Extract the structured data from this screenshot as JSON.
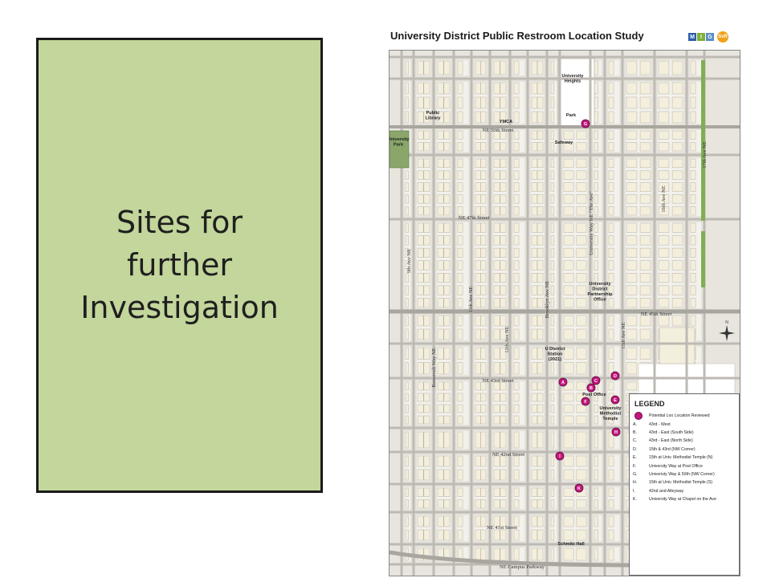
{
  "slide": {
    "box_text": "Sites for further Investigation",
    "box_color": "#c3d69b"
  },
  "map": {
    "title": "University District Public Restroom Location Study",
    "logo_letters": [
      "M",
      "I",
      "G",
      "SvR"
    ],
    "street_labels": [
      {
        "id": "ne50",
        "text": "NE 50th Street"
      },
      {
        "id": "ne47",
        "text": "NE 47th Street"
      },
      {
        "id": "ne45",
        "text": "NE 45th Street"
      },
      {
        "id": "ne43",
        "text": "NE 43rd Street"
      },
      {
        "id": "ne42",
        "text": "NE 42nd Street"
      },
      {
        "id": "ne41",
        "text": "NE 41st Street"
      },
      {
        "id": "campus",
        "text": "NE Campus Parkway"
      },
      {
        "id": "ave9",
        "text": "9th Ave NE"
      },
      {
        "id": "ave11",
        "text": "11th Ave NE"
      },
      {
        "id": "ave12",
        "text": "12th Ave NE"
      },
      {
        "id": "brooklyn",
        "text": "Brooklyn Ave NE"
      },
      {
        "id": "univway",
        "text": "University Way NE \"The Ave\""
      },
      {
        "id": "ave15",
        "text": "15th Ave NE"
      },
      {
        "id": "ave16",
        "text": "16th Ave NE"
      },
      {
        "id": "ave17",
        "text": "17th Ave NE"
      },
      {
        "id": "roosevelt",
        "text": "Roosevelt Way NE"
      }
    ],
    "place_labels": [
      {
        "id": "uheights",
        "lines": [
          "University",
          "Heights"
        ]
      },
      {
        "id": "park",
        "lines": [
          "Park"
        ]
      },
      {
        "id": "library",
        "lines": [
          "Public",
          "Library"
        ]
      },
      {
        "id": "ymca",
        "lines": [
          "YMCA"
        ]
      },
      {
        "id": "safeway",
        "lines": [
          "Safeway"
        ]
      },
      {
        "id": "upark",
        "lines": [
          "University",
          "Park"
        ]
      },
      {
        "id": "partnership",
        "lines": [
          "University",
          "District",
          "Partnership",
          "Office"
        ]
      },
      {
        "id": "station",
        "lines": [
          "U District",
          "Station",
          "(2021)"
        ]
      },
      {
        "id": "postoffice",
        "lines": [
          "Post Office"
        ]
      },
      {
        "id": "methodist",
        "lines": [
          "University",
          "Methodist",
          "Temple"
        ]
      },
      {
        "id": "schmitz",
        "lines": [
          "Schmitz Hall"
        ]
      }
    ],
    "markers": [
      "A",
      "B",
      "C",
      "D",
      "E",
      "F",
      "G",
      "H",
      "I",
      "K"
    ],
    "compass": "N",
    "marker_color": "#c4167e"
  },
  "legend": {
    "title": "LEGEND",
    "dot_label": "Potential Loo Location Reviewed",
    "items": [
      {
        "letter": "A.",
        "text": "43rd - West"
      },
      {
        "letter": "B.",
        "text": "43rd - East (South Side)"
      },
      {
        "letter": "C.",
        "text": "43rd - East (North Side)"
      },
      {
        "letter": "D.",
        "text": "15th & 43rd (NW Corner)"
      },
      {
        "letter": "E.",
        "text": "15th at Univ. Methodist Temple (N)"
      },
      {
        "letter": "F.",
        "text": "University Way at Post Office"
      },
      {
        "letter": "G.",
        "text": "Univeristy Way & 50th (NW Corner)"
      },
      {
        "letter": "H.",
        "text": "15th at Univ. Methodist Temple (S)"
      },
      {
        "letter": "I.",
        "text": "42nd and Alleyway"
      },
      {
        "letter": "K.",
        "text": "University Way at Chapel on the Ave"
      }
    ]
  }
}
